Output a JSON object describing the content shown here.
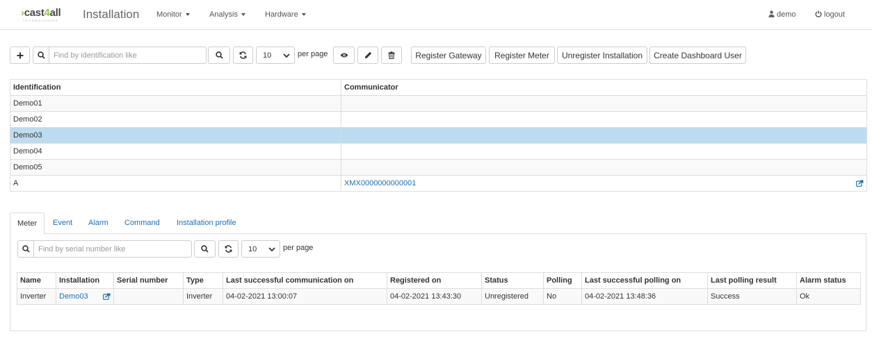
{
  "brand": {
    "name_prefix": "cast",
    "name_digit": "4",
    "name_suffix": "all",
    "tagline": "TECHNOLOGIES",
    "accent_color": "#8cc63f"
  },
  "page_title": "Installation",
  "nav": {
    "menus": [
      {
        "label": "Monitor"
      },
      {
        "label": "Analysis"
      },
      {
        "label": "Hardware"
      }
    ],
    "user_label": "demo",
    "logout_label": "logout"
  },
  "toolbar": {
    "search_placeholder": "Find by identification like",
    "per_page_value": "10",
    "per_page_label": "per page",
    "actions": {
      "register_gateway": "Register Gateway",
      "register_meter": "Register Meter",
      "unregister_installation": "Unregister Installation",
      "create_dashboard_user": "Create Dashboard User"
    }
  },
  "installations": {
    "columns": [
      "Identification",
      "Communicator"
    ],
    "rows": [
      {
        "identification": "Demo01",
        "communicator": ""
      },
      {
        "identification": "Demo02",
        "communicator": ""
      },
      {
        "identification": "Demo03",
        "communicator": "",
        "selected": true
      },
      {
        "identification": "Demo04",
        "communicator": ""
      },
      {
        "identification": "Demo05",
        "communicator": ""
      },
      {
        "identification": "A",
        "communicator": "XMX0000000000001"
      }
    ],
    "selection_color": "#bddcef"
  },
  "tabs": [
    {
      "label": "Meter",
      "active": true
    },
    {
      "label": "Event"
    },
    {
      "label": "Alarm"
    },
    {
      "label": "Command"
    },
    {
      "label": "Installation profile"
    }
  ],
  "meter_panel": {
    "search_placeholder": "Find by serial number like",
    "per_page_value": "10",
    "per_page_label": "per page",
    "columns": [
      "Name",
      "Installation",
      "Serial number",
      "Type",
      "Last successful communication on",
      "Registered on",
      "Status",
      "Polling",
      "Last successful polling on",
      "Last polling result",
      "Alarm status"
    ],
    "rows": [
      {
        "name": "Inverter",
        "installation": "Demo03",
        "serial_number": "",
        "type": "Inverter",
        "last_comm": "04-02-2021 13:00:07",
        "registered_on": "04-02-2021 13:43:30",
        "status": "Unregistered",
        "polling": "No",
        "last_polling": "04-02-2021 13:48:36",
        "last_polling_result": "Success",
        "alarm_status": "Ok"
      }
    ]
  },
  "colors": {
    "link": "#1f6fb2",
    "border": "#dddddd"
  }
}
